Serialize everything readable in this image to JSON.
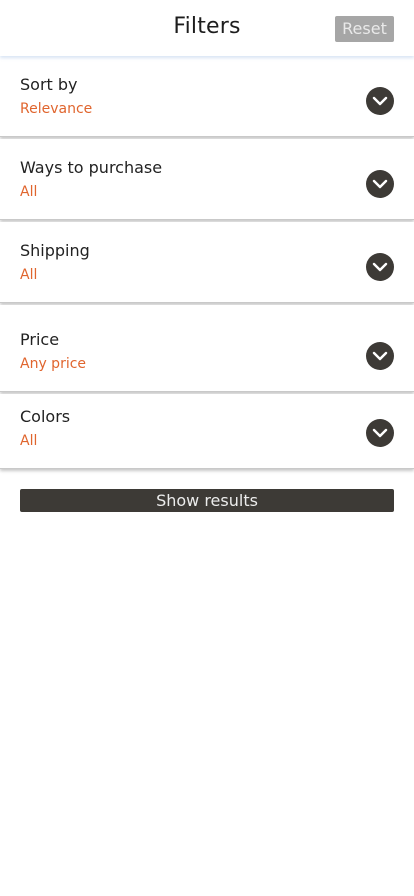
{
  "header": {
    "title": "Filters",
    "reset_label": "Reset"
  },
  "filters": [
    {
      "label": "Sort by",
      "value": "Relevance"
    },
    {
      "label": "Ways to purchase",
      "value": "All"
    },
    {
      "label": "Shipping",
      "value": "All"
    },
    {
      "label": "Price",
      "value": "Any price"
    },
    {
      "label": "Colors",
      "value": "All"
    }
  ],
  "actions": {
    "show_results_label": "Show results"
  },
  "colors": {
    "accent": "#e0652e",
    "dark": "#3d3a36",
    "reset_bg": "#a6a6a6"
  }
}
